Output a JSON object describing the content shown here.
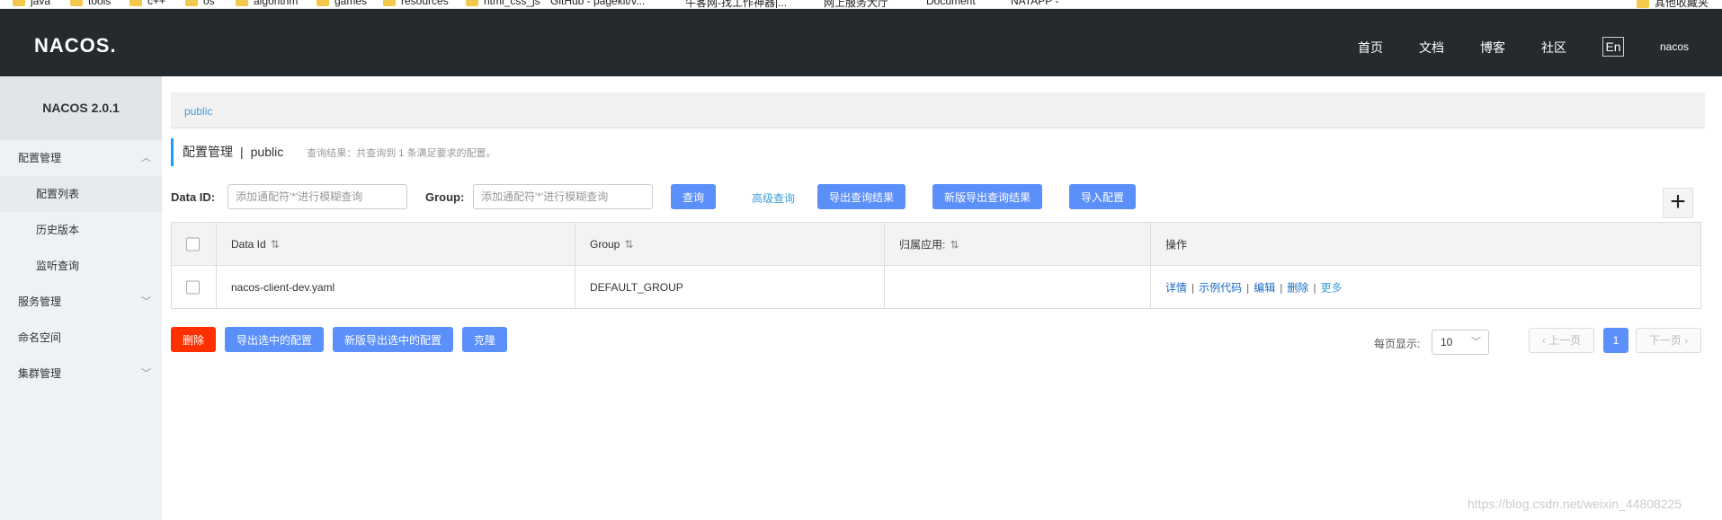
{
  "bookmarks": [
    "java",
    "tools",
    "c++",
    "os",
    "algorithm",
    "games",
    "resources",
    "html_css_js",
    "GitHub - pagekit/v...",
    "牛客网-找工作神器|...",
    "网上服务大厅",
    "Document",
    "NATAPP -",
    "其他收藏夹"
  ],
  "header": {
    "logo": "NACOS.",
    "nav": [
      "首页",
      "文档",
      "博客",
      "社区"
    ],
    "lang": "En",
    "user": "nacos"
  },
  "sidebar": {
    "version": "NACOS 2.0.1",
    "items": [
      {
        "label": "配置管理",
        "chevron": "up"
      },
      {
        "label": "配置列表"
      },
      {
        "label": "历史版本"
      },
      {
        "label": "监听查询"
      },
      {
        "label": "服务管理",
        "chevron": "down"
      },
      {
        "label": "命名空间"
      },
      {
        "label": "集群管理",
        "chevron": "down"
      }
    ]
  },
  "breadcrumb": "public",
  "title": {
    "main": "配置管理",
    "separator": "|",
    "namespace": "public",
    "result": "查询结果：共查询到 1 条满足要求的配置。"
  },
  "search": {
    "dataid_label": "Data ID:",
    "dataid_placeholder": "添加通配符'*'进行模糊查询",
    "group_label": "Group:",
    "group_placeholder": "添加通配符'*'进行模糊查询",
    "query_btn": "查询",
    "advanced": "高级查询",
    "export_btn": "导出查询结果",
    "new_export_btn": "新版导出查询结果",
    "import_btn": "导入配置"
  },
  "table": {
    "headers": [
      "Data Id",
      "Group",
      "归属应用:",
      "操作"
    ],
    "rows": [
      {
        "dataid": "nacos-client-dev.yaml",
        "group": "DEFAULT_GROUP",
        "app": "",
        "ops": [
          "详情",
          "示例代码",
          "编辑",
          "删除",
          "更多"
        ]
      }
    ]
  },
  "bulk": {
    "delete": "删除",
    "export_selected": "导出选中的配置",
    "new_export_selected": "新版导出选中的配置",
    "clone": "克隆"
  },
  "pagination": {
    "per_page_label": "每页显示:",
    "per_page": "10",
    "prev": "上一页",
    "current": "1",
    "next": "下一页"
  },
  "watermark": "https://blog.csdn.net/weixin_44808225"
}
